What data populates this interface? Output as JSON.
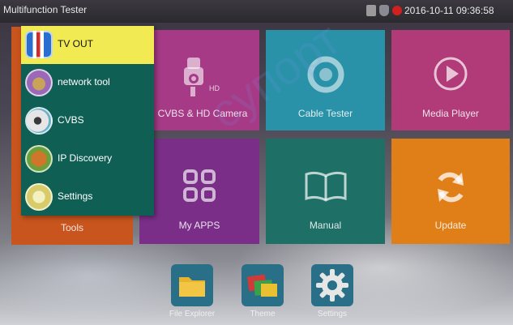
{
  "statusbar": {
    "app_title": "Multifunction Tester",
    "datetime": "2016-10-11 09:36:58"
  },
  "tiles": {
    "tools": "Tools",
    "cvbs_hd_camera": "CVBS & HD Camera",
    "cvbs_hd_badge": "HD",
    "cable_tester": "Cable Tester",
    "media_player": "Media Player",
    "my_apps": "My APPS",
    "manual": "Manual",
    "update": "Update"
  },
  "tools_menu": {
    "items": [
      {
        "label": "TV OUT",
        "icon": "tv-out-icon",
        "selected": true
      },
      {
        "label": "network tool",
        "icon": "network-tool-icon"
      },
      {
        "label": "CVBS",
        "icon": "cvbs-camera-icon"
      },
      {
        "label": "IP Discovery",
        "icon": "ip-discovery-icon"
      },
      {
        "label": "Settings",
        "icon": "settings-icon"
      }
    ]
  },
  "dock": {
    "file_explorer": "File Explorer",
    "theme": "Theme",
    "settings": "Settings"
  },
  "watermark": "супорт"
}
